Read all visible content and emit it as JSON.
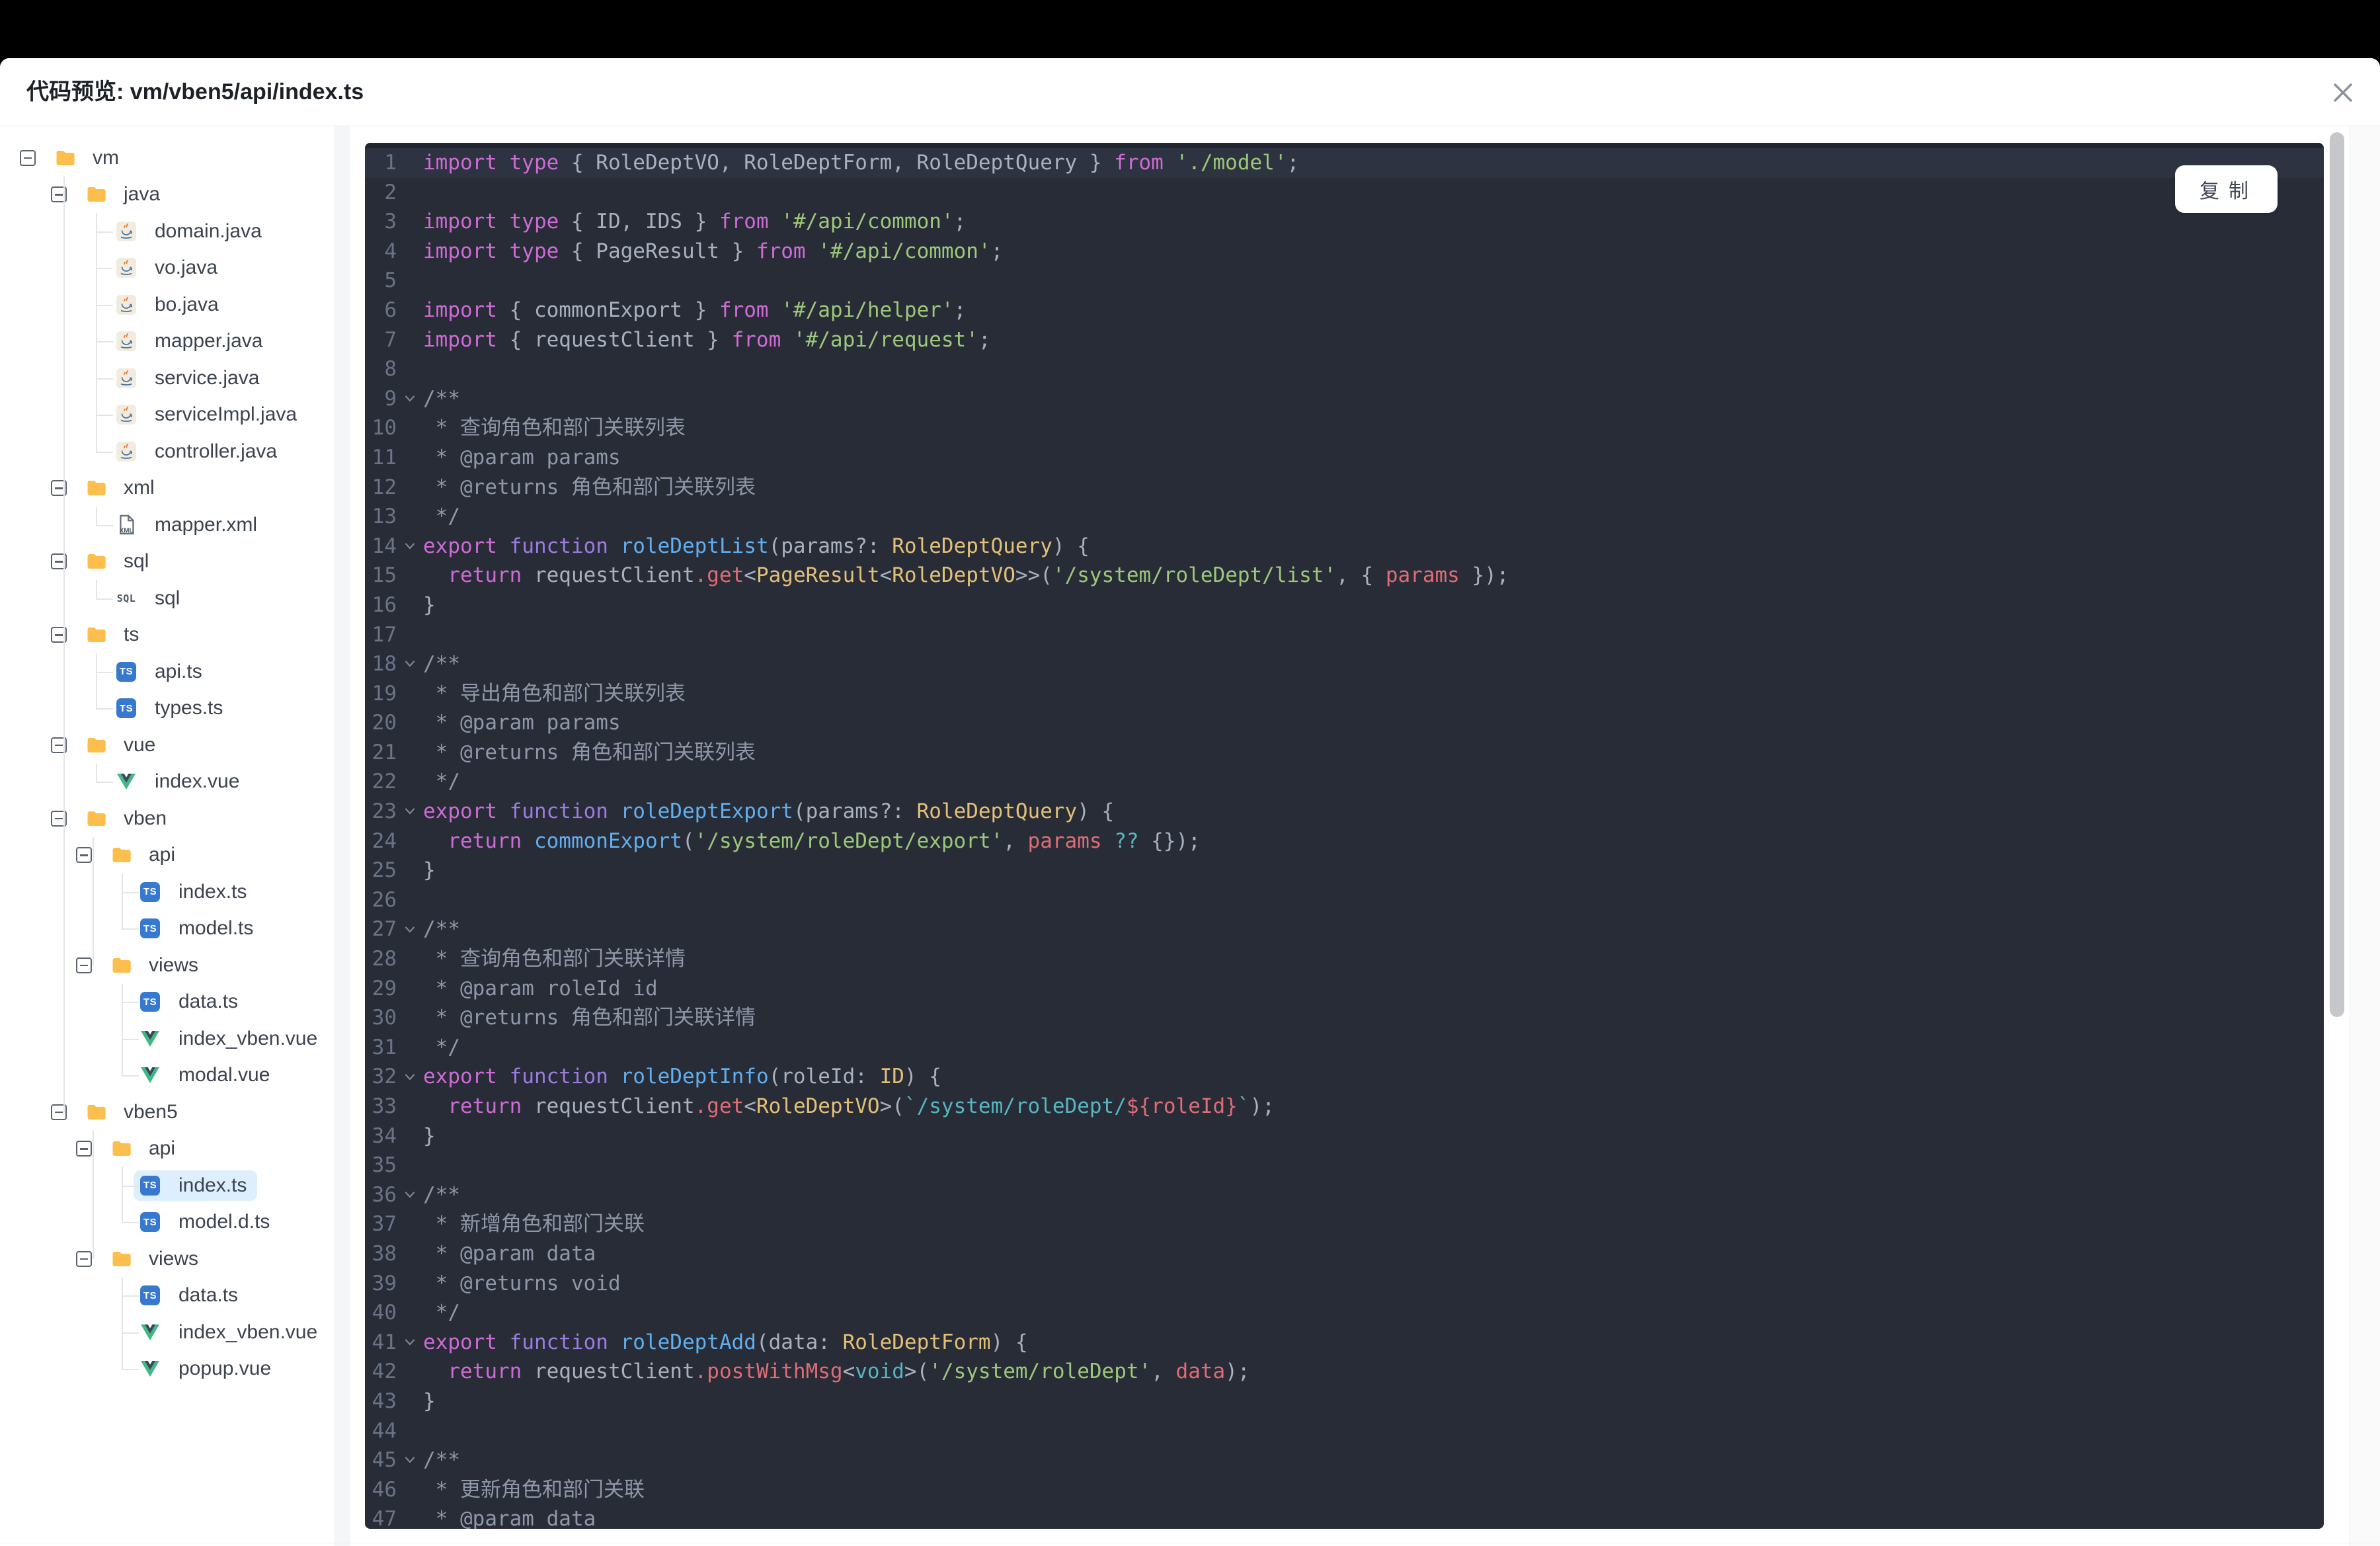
{
  "dialog": {
    "title": "代码预览: vm/vben5/api/index.ts",
    "close_glyph": "✕"
  },
  "colors": {
    "panel_bg": "#272c37",
    "selected_row_bg": "#ddeefd",
    "folder_icon": "#fcbf4e",
    "ts_icon_bg": "#3779cf",
    "vue_icon_green": "#41b883",
    "vue_icon_dark": "#35495e",
    "syntax_keyword": "#cf6bd6",
    "syntax_function_kw": "#9d7ce0",
    "syntax_function_name": "#61afef",
    "syntax_type": "#e3c078",
    "syntax_string": "#9dc87a",
    "syntax_property": "#e06c75",
    "syntax_operator": "#56b6c2",
    "syntax_comment": "#8f97a8",
    "syntax_default": "#a9b1bf"
  },
  "tree": {
    "items": [
      {
        "label": "vm",
        "icon": "folder",
        "kind": "folder",
        "level": 0
      },
      {
        "label": "java",
        "icon": "folder",
        "kind": "folder",
        "level": 1
      },
      {
        "label": "domain.java",
        "icon": "java",
        "kind": "file",
        "level": 2
      },
      {
        "label": "vo.java",
        "icon": "java",
        "kind": "file",
        "level": 2
      },
      {
        "label": "bo.java",
        "icon": "java",
        "kind": "file",
        "level": 2
      },
      {
        "label": "mapper.java",
        "icon": "java",
        "kind": "file",
        "level": 2
      },
      {
        "label": "service.java",
        "icon": "java",
        "kind": "file",
        "level": 2
      },
      {
        "label": "serviceImpl.java",
        "icon": "java",
        "kind": "file",
        "level": 2
      },
      {
        "label": "controller.java",
        "icon": "java",
        "kind": "file",
        "level": 2
      },
      {
        "label": "xml",
        "icon": "folder",
        "kind": "folder",
        "level": 1
      },
      {
        "label": "mapper.xml",
        "icon": "xml",
        "kind": "file",
        "level": 2
      },
      {
        "label": "sql",
        "icon": "folder",
        "kind": "folder",
        "level": 1
      },
      {
        "label": "sql",
        "icon": "sql",
        "kind": "file",
        "level": 2
      },
      {
        "label": "ts",
        "icon": "folder",
        "kind": "folder",
        "level": 1
      },
      {
        "label": "api.ts",
        "icon": "ts",
        "kind": "file",
        "level": 2
      },
      {
        "label": "types.ts",
        "icon": "ts",
        "kind": "file",
        "level": 2
      },
      {
        "label": "vue",
        "icon": "folder",
        "kind": "folder",
        "level": 1
      },
      {
        "label": "index.vue",
        "icon": "vue",
        "kind": "file",
        "level": 2
      },
      {
        "label": "vben",
        "icon": "folder",
        "kind": "folder",
        "level": 1
      },
      {
        "label": "api",
        "icon": "folder",
        "kind": "folder",
        "level": 2
      },
      {
        "label": "index.ts",
        "icon": "ts",
        "kind": "file",
        "level": 3
      },
      {
        "label": "model.ts",
        "icon": "ts",
        "kind": "file",
        "level": 3
      },
      {
        "label": "views",
        "icon": "folder",
        "kind": "folder",
        "level": 2
      },
      {
        "label": "data.ts",
        "icon": "ts",
        "kind": "file",
        "level": 3
      },
      {
        "label": "index_vben.vue",
        "icon": "vue",
        "kind": "file",
        "level": 3
      },
      {
        "label": "modal.vue",
        "icon": "vue",
        "kind": "file",
        "level": 3
      },
      {
        "label": "vben5",
        "icon": "folder",
        "kind": "folder",
        "level": 1
      },
      {
        "label": "api",
        "icon": "folder",
        "kind": "folder",
        "level": 2
      },
      {
        "label": "index.ts",
        "icon": "ts",
        "kind": "file",
        "level": 3,
        "selected": true
      },
      {
        "label": "model.d.ts",
        "icon": "ts",
        "kind": "file",
        "level": 3
      },
      {
        "label": "views",
        "icon": "folder",
        "kind": "folder",
        "level": 2
      },
      {
        "label": "data.ts",
        "icon": "ts",
        "kind": "file",
        "level": 3
      },
      {
        "label": "index_vben.vue",
        "icon": "vue",
        "kind": "file",
        "level": 3
      },
      {
        "label": "popup.vue",
        "icon": "vue",
        "kind": "file",
        "level": 3
      }
    ]
  },
  "code": {
    "copy_label": "复制",
    "lines": [
      {
        "no": 1,
        "tokens": [
          [
            "k",
            "import type"
          ],
          [
            "d",
            " { RoleDeptVO, RoleDeptForm, RoleDeptQuery } "
          ],
          [
            "k",
            "from"
          ],
          [
            "d",
            " "
          ],
          [
            "s",
            "'./model'"
          ],
          [
            "d",
            ";"
          ]
        ]
      },
      {
        "no": 2,
        "tokens": []
      },
      {
        "no": 3,
        "tokens": [
          [
            "k",
            "import type"
          ],
          [
            "d",
            " { ID, IDS } "
          ],
          [
            "k",
            "from"
          ],
          [
            "d",
            " "
          ],
          [
            "s",
            "'#/api/common'"
          ],
          [
            "d",
            ";"
          ]
        ]
      },
      {
        "no": 4,
        "tokens": [
          [
            "k",
            "import type"
          ],
          [
            "d",
            " { PageResult } "
          ],
          [
            "k",
            "from"
          ],
          [
            "d",
            " "
          ],
          [
            "s",
            "'#/api/common'"
          ],
          [
            "d",
            ";"
          ]
        ]
      },
      {
        "no": 5,
        "tokens": []
      },
      {
        "no": 6,
        "tokens": [
          [
            "k",
            "import"
          ],
          [
            "d",
            " { commonExport } "
          ],
          [
            "k",
            "from"
          ],
          [
            "d",
            " "
          ],
          [
            "s",
            "'#/api/helper'"
          ],
          [
            "d",
            ";"
          ]
        ]
      },
      {
        "no": 7,
        "tokens": [
          [
            "k",
            "import"
          ],
          [
            "d",
            " { requestClient } "
          ],
          [
            "k",
            "from"
          ],
          [
            "d",
            " "
          ],
          [
            "s",
            "'#/api/request'"
          ],
          [
            "d",
            ";"
          ]
        ]
      },
      {
        "no": 8,
        "tokens": []
      },
      {
        "no": 9,
        "fold": true,
        "tokens": [
          [
            "c",
            "/**"
          ]
        ]
      },
      {
        "no": 10,
        "tokens": [
          [
            "c",
            " * 查询角色和部门关联列表"
          ]
        ]
      },
      {
        "no": 11,
        "tokens": [
          [
            "c",
            " * @param params"
          ]
        ]
      },
      {
        "no": 12,
        "tokens": [
          [
            "c",
            " * @returns 角色和部门关联列表"
          ]
        ]
      },
      {
        "no": 13,
        "tokens": [
          [
            "c",
            " */"
          ]
        ]
      },
      {
        "no": 14,
        "fold": true,
        "tokens": [
          [
            "k",
            "export "
          ],
          [
            "f",
            "function "
          ],
          [
            "n",
            "roleDeptList"
          ],
          [
            "d",
            "(params?: "
          ],
          [
            "t",
            "RoleDeptQuery"
          ],
          [
            "d",
            ") {"
          ]
        ]
      },
      {
        "no": 15,
        "tokens": [
          [
            "d",
            "  "
          ],
          [
            "k",
            "return "
          ],
          [
            "d",
            "requestClient"
          ],
          [
            "p",
            ".get"
          ],
          [
            "d",
            "<"
          ],
          [
            "t",
            "PageResult"
          ],
          [
            "d",
            "<"
          ],
          [
            "t",
            "RoleDeptVO"
          ],
          [
            "d",
            ">>("
          ],
          [
            "s",
            "'/system/roleDept/list'"
          ],
          [
            "d",
            ", { "
          ],
          [
            "p",
            "params"
          ],
          [
            "d",
            " });"
          ]
        ]
      },
      {
        "no": 16,
        "tokens": [
          [
            "d",
            "}"
          ]
        ]
      },
      {
        "no": 17,
        "tokens": []
      },
      {
        "no": 18,
        "fold": true,
        "tokens": [
          [
            "c",
            "/**"
          ]
        ]
      },
      {
        "no": 19,
        "tokens": [
          [
            "c",
            " * 导出角色和部门关联列表"
          ]
        ]
      },
      {
        "no": 20,
        "tokens": [
          [
            "c",
            " * @param params"
          ]
        ]
      },
      {
        "no": 21,
        "tokens": [
          [
            "c",
            " * @returns 角色和部门关联列表"
          ]
        ]
      },
      {
        "no": 22,
        "tokens": [
          [
            "c",
            " */"
          ]
        ]
      },
      {
        "no": 23,
        "fold": true,
        "tokens": [
          [
            "k",
            "export "
          ],
          [
            "f",
            "function "
          ],
          [
            "n",
            "roleDeptExport"
          ],
          [
            "d",
            "(params?: "
          ],
          [
            "t",
            "RoleDeptQuery"
          ],
          [
            "d",
            ") {"
          ]
        ]
      },
      {
        "no": 24,
        "tokens": [
          [
            "d",
            "  "
          ],
          [
            "k",
            "return "
          ],
          [
            "n",
            "commonExport"
          ],
          [
            "d",
            "("
          ],
          [
            "s",
            "'/system/roleDept/export'"
          ],
          [
            "d",
            ", "
          ],
          [
            "p",
            "params"
          ],
          [
            "d",
            " "
          ],
          [
            "o",
            "??"
          ],
          [
            "d",
            " {});"
          ]
        ]
      },
      {
        "no": 25,
        "tokens": [
          [
            "d",
            "}"
          ]
        ]
      },
      {
        "no": 26,
        "tokens": []
      },
      {
        "no": 27,
        "fold": true,
        "tokens": [
          [
            "c",
            "/**"
          ]
        ]
      },
      {
        "no": 28,
        "tokens": [
          [
            "c",
            " * 查询角色和部门关联详情"
          ]
        ]
      },
      {
        "no": 29,
        "tokens": [
          [
            "c",
            " * @param roleId id"
          ]
        ]
      },
      {
        "no": 30,
        "tokens": [
          [
            "c",
            " * @returns 角色和部门关联详情"
          ]
        ]
      },
      {
        "no": 31,
        "tokens": [
          [
            "c",
            " */"
          ]
        ]
      },
      {
        "no": 32,
        "fold": true,
        "tokens": [
          [
            "k",
            "export "
          ],
          [
            "f",
            "function "
          ],
          [
            "n",
            "roleDeptInfo"
          ],
          [
            "d",
            "(roleId: "
          ],
          [
            "t",
            "ID"
          ],
          [
            "d",
            ") {"
          ]
        ]
      },
      {
        "no": 33,
        "tokens": [
          [
            "d",
            "  "
          ],
          [
            "k",
            "return "
          ],
          [
            "d",
            "requestClient"
          ],
          [
            "p",
            ".get"
          ],
          [
            "d",
            "<"
          ],
          [
            "t",
            "RoleDeptVO"
          ],
          [
            "d",
            ">("
          ],
          [
            "o",
            "`/system/roleDept/"
          ],
          [
            "p",
            "${roleId}"
          ],
          [
            "o",
            "`"
          ],
          [
            "d",
            ");"
          ]
        ]
      },
      {
        "no": 34,
        "tokens": [
          [
            "d",
            "}"
          ]
        ]
      },
      {
        "no": 35,
        "tokens": []
      },
      {
        "no": 36,
        "fold": true,
        "tokens": [
          [
            "c",
            "/**"
          ]
        ]
      },
      {
        "no": 37,
        "tokens": [
          [
            "c",
            " * 新增角色和部门关联"
          ]
        ]
      },
      {
        "no": 38,
        "tokens": [
          [
            "c",
            " * @param data"
          ]
        ]
      },
      {
        "no": 39,
        "tokens": [
          [
            "c",
            " * @returns void"
          ]
        ]
      },
      {
        "no": 40,
        "tokens": [
          [
            "c",
            " */"
          ]
        ]
      },
      {
        "no": 41,
        "fold": true,
        "tokens": [
          [
            "k",
            "export "
          ],
          [
            "f",
            "function "
          ],
          [
            "n",
            "roleDeptAdd"
          ],
          [
            "d",
            "(data: "
          ],
          [
            "t",
            "RoleDeptForm"
          ],
          [
            "d",
            ") {"
          ]
        ]
      },
      {
        "no": 42,
        "tokens": [
          [
            "d",
            "  "
          ],
          [
            "k",
            "return "
          ],
          [
            "d",
            "requestClient"
          ],
          [
            "p",
            ".postWithMsg"
          ],
          [
            "d",
            "<"
          ],
          [
            "o",
            "void"
          ],
          [
            "d",
            ">("
          ],
          [
            "s",
            "'/system/roleDept'"
          ],
          [
            "d",
            ", "
          ],
          [
            "p",
            "data"
          ],
          [
            "d",
            ");"
          ]
        ]
      },
      {
        "no": 43,
        "tokens": [
          [
            "d",
            "}"
          ]
        ]
      },
      {
        "no": 44,
        "tokens": []
      },
      {
        "no": 45,
        "fold": true,
        "tokens": [
          [
            "c",
            "/**"
          ]
        ]
      },
      {
        "no": 46,
        "tokens": [
          [
            "c",
            " * 更新角色和部门关联"
          ]
        ]
      },
      {
        "no": 47,
        "tokens": [
          [
            "c",
            " * @param data"
          ]
        ]
      }
    ]
  }
}
